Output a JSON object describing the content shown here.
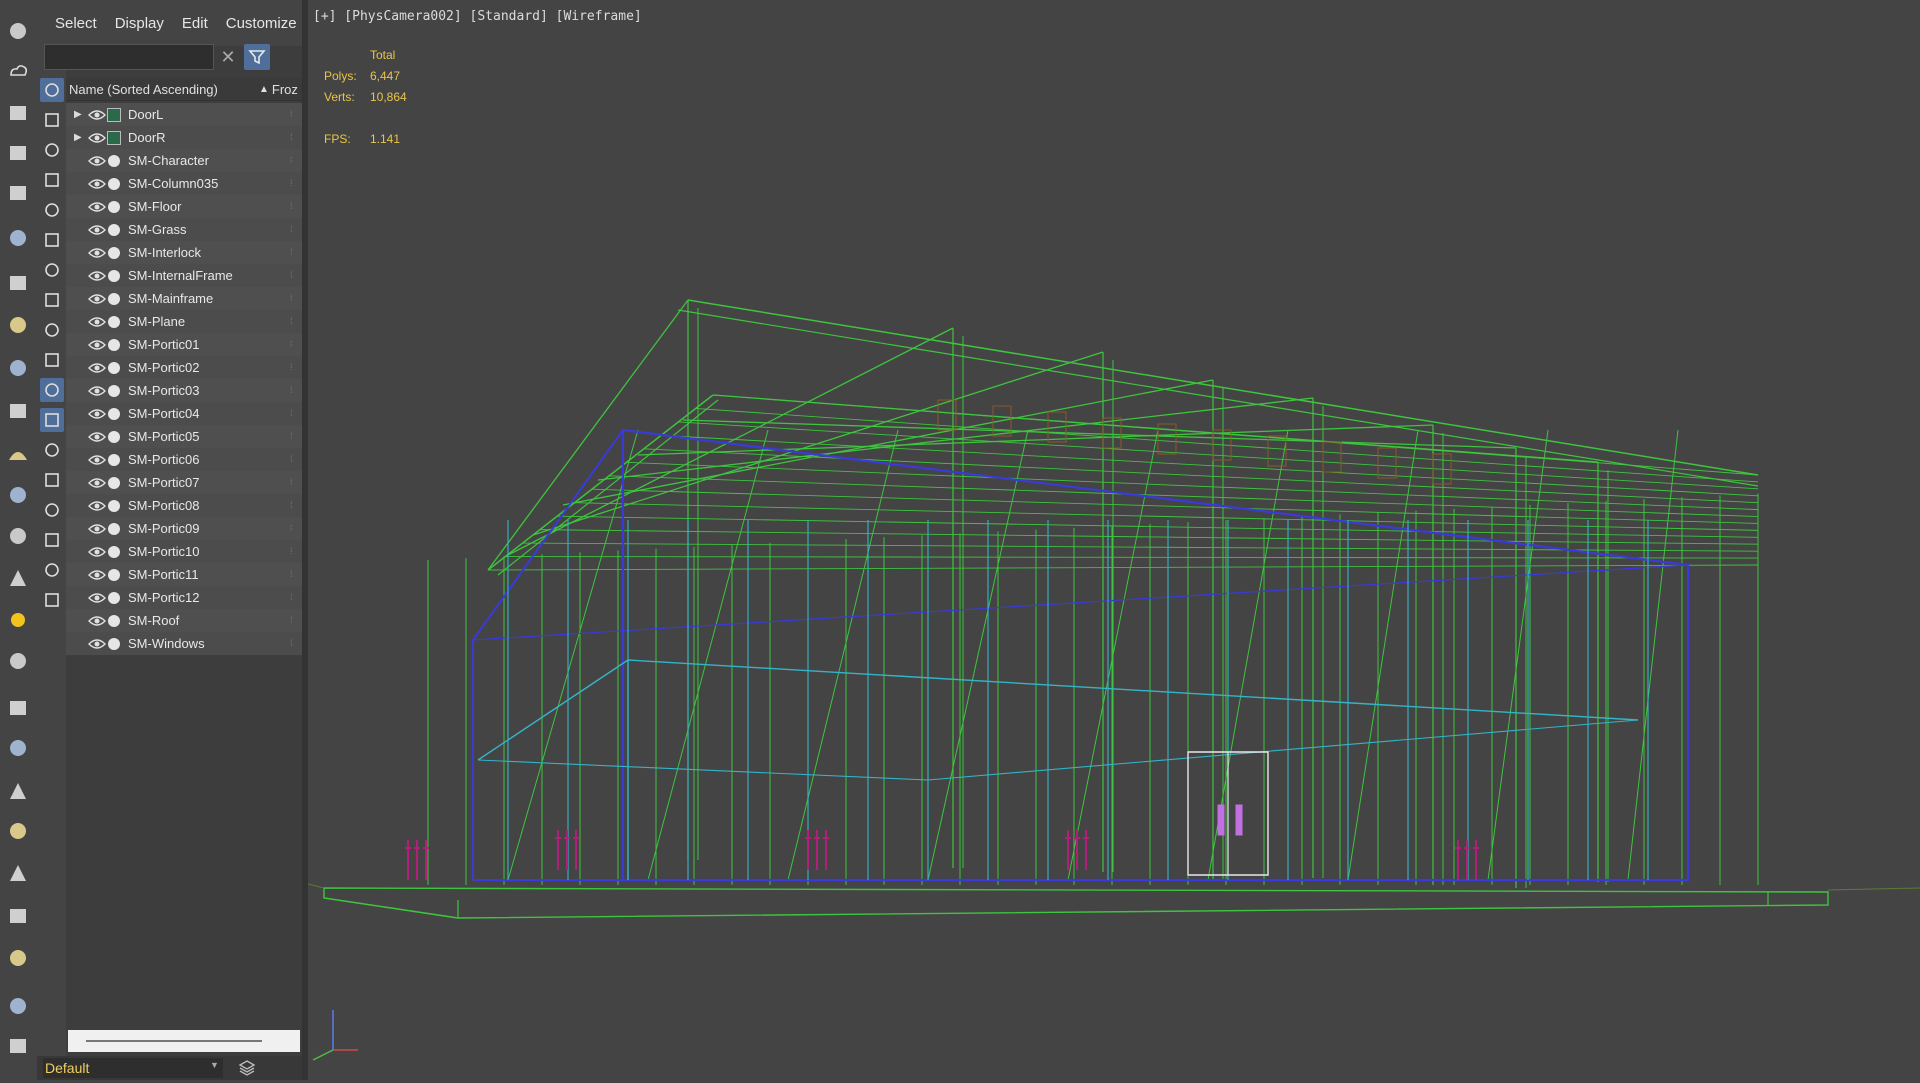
{
  "menu": [
    "Select",
    "Display",
    "Edit",
    "Customize"
  ],
  "search": {
    "value": "",
    "placeholder": ""
  },
  "scene_explorer": {
    "column_name": "Name (Sorted Ascending)",
    "column_frozen": "Froz",
    "items": [
      {
        "name": "DoorL",
        "group": true
      },
      {
        "name": "DoorR",
        "group": true
      },
      {
        "name": "SM-Character",
        "group": false
      },
      {
        "name": "SM-Column035",
        "group": false
      },
      {
        "name": "SM-Floor",
        "group": false
      },
      {
        "name": "SM-Grass",
        "group": false
      },
      {
        "name": "SM-Interlock",
        "group": false
      },
      {
        "name": "SM-InternalFrame",
        "group": false
      },
      {
        "name": "SM-Mainframe",
        "group": false
      },
      {
        "name": "SM-Plane",
        "group": false
      },
      {
        "name": "SM-Portic01",
        "group": false
      },
      {
        "name": "SM-Portic02",
        "group": false
      },
      {
        "name": "SM-Portic03",
        "group": false
      },
      {
        "name": "SM-Portic04",
        "group": false
      },
      {
        "name": "SM-Portic05",
        "group": false
      },
      {
        "name": "SM-Portic06",
        "group": false
      },
      {
        "name": "SM-Portic07",
        "group": false
      },
      {
        "name": "SM-Portic08",
        "group": false
      },
      {
        "name": "SM-Portic09",
        "group": false
      },
      {
        "name": "SM-Portic10",
        "group": false
      },
      {
        "name": "SM-Portic11",
        "group": false
      },
      {
        "name": "SM-Portic12",
        "group": false
      },
      {
        "name": "SM-Roof",
        "group": false
      },
      {
        "name": "SM-Windows",
        "group": false
      }
    ]
  },
  "layer": {
    "current": "Default"
  },
  "viewport": {
    "label": "[+] [PhysCamera002] [Standard] [Wireframe]",
    "stats": {
      "header": "Total",
      "polys_label": "Polys:",
      "polys_value": "6,447",
      "verts_label": "Verts:",
      "verts_value": "10,864",
      "fps_label": "FPS:",
      "fps_value": "1.141"
    }
  },
  "colors": {
    "panel_bg": "#3d3d3d",
    "viewport_bg": "#444444",
    "accent": "#4f6f9a",
    "stats_text": "#e8c54a",
    "wire_green": "#3ec43e",
    "wire_blue": "#3a3ad8",
    "wire_cyan": "#34b4c8",
    "wire_magenta": "#b0207a"
  },
  "toolbar_icons": [
    "teapot-icon",
    "cloud-icon",
    "render-frame-icon",
    "sheet-icon",
    "table-icon",
    "light-icon",
    "camera-rig-icon",
    "clock-icon",
    "film-camera-icon",
    "rectangle-icon",
    "hill-icon",
    "sphere-icon",
    "hand-icon",
    "cone-icon",
    "sun-icon",
    "ball-icon",
    "grid-icon",
    "connect-icon",
    "pyramid-icon",
    "gear-icon",
    "grass-icon",
    "hf-icon",
    "texture-icon",
    "material-icon",
    "settings-icon"
  ],
  "explorer_icons": [
    "display-all-icon",
    "geometry-icon",
    "light-bulb-icon",
    "camera-icon",
    "shape-icon",
    "spacewarp-icon",
    "helper-icon",
    "bone-icon",
    "wrench-icon",
    "container-icon",
    "freeze-icon",
    "visibility-icon",
    "list-icon",
    "square-icon",
    "doc-icon",
    "filter-funnel-icon",
    "filter-icon",
    "folder-icon"
  ]
}
